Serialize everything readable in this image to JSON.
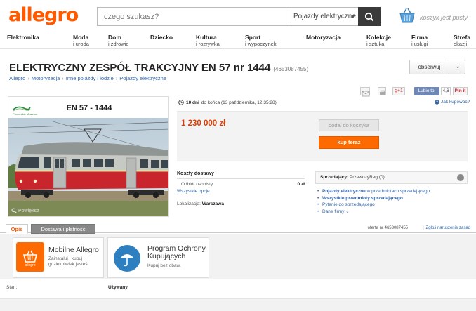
{
  "header": {
    "logo": "allegro",
    "search_placeholder": "czego szukasz?",
    "search_category": "Pojazdy elektryczne",
    "cart_text": "koszyk jest pusty"
  },
  "categories": [
    {
      "title": "Elektronika",
      "sub": ""
    },
    {
      "title": "Moda",
      "sub": "i uroda"
    },
    {
      "title": "Dom",
      "sub": "i zdrowie"
    },
    {
      "title": "Dziecko",
      "sub": ""
    },
    {
      "title": "Kultura",
      "sub": "i rozrywka"
    },
    {
      "title": "Sport",
      "sub": "i wypoczynek"
    },
    {
      "title": "Motoryzacja",
      "sub": ""
    },
    {
      "title": "Kolekcje",
      "sub": "i sztuka"
    },
    {
      "title": "Firma",
      "sub": "i usługi"
    },
    {
      "title": "Strefa",
      "sub": "okazji"
    }
  ],
  "offer": {
    "title": "ELEKTRYCZNY ZESPÓŁ TRAKCYJNY EN 57 nr 1444",
    "id": "(4653087455)",
    "watch": "obserwuj",
    "breadcrumb": [
      "Allegro",
      "Motoryzacja",
      "Inne pojazdy i łodzie",
      "Pojazdy elektryczne"
    ],
    "image_caption": "EN 57 - 1444",
    "image_logo": "Pomorskie Muzeum",
    "zoom": "Powiększ",
    "time_bold": "10 dni",
    "time_rest": "do końca (13 października, 12:35:28)",
    "price": "1 230 000 zł",
    "add_to_cart": "dodaj do koszyka",
    "buy_now": "kup teraz",
    "how_to_buy": "Jak kupować?"
  },
  "social": {
    "gplus": "g+1",
    "fb_like": "Lubię to!",
    "fb_count": "4,6",
    "pin": "Pin it"
  },
  "shipping": {
    "title": "Koszty dostawy",
    "row_label": "Odbiór osobisty",
    "row_value": "0 zł",
    "all_options": "Wszystkie opcje",
    "location_label": "Lokalizacja:",
    "location_value": "Warszawa"
  },
  "seller": {
    "label": "Sprzedający:",
    "name": "PrzewozyReg",
    "rating": "(0)",
    "links": [
      {
        "bold": "Pojazdy elektryczne",
        "rest": "w przedmiotach sprzedającego",
        "style": "mixed"
      },
      {
        "bold": "Wszystkie przedmioty sprzedającego",
        "rest": "",
        "style": "bold"
      },
      {
        "bold": "",
        "rest": "Pytanie do sprzedającego",
        "style": "plain"
      },
      {
        "bold": "",
        "rest": "Dane firmy",
        "style": "plain"
      }
    ]
  },
  "tabs": {
    "desc": "Opis",
    "shipping": "Dostawa i płatność",
    "offer_number": "oferta nr 4653087455",
    "report": "Zgłoś naruszenie zasad"
  },
  "promos": {
    "card1_title": "Mobilne Allegro",
    "card1_sub": "Zainstaluj i kupuj gdziekolwiek jesteś",
    "card1_icon_label": "allegro",
    "card2_title": "Program Ochrony Kupujących",
    "card2_sub": "Kupuj bez obaw."
  },
  "state": {
    "label": "Stan:",
    "value": "Używany"
  },
  "colors": {
    "brand": "#ff5a00",
    "link": "#3366aa",
    "price": "#e03c00",
    "buy_button": "#ff6a00"
  }
}
